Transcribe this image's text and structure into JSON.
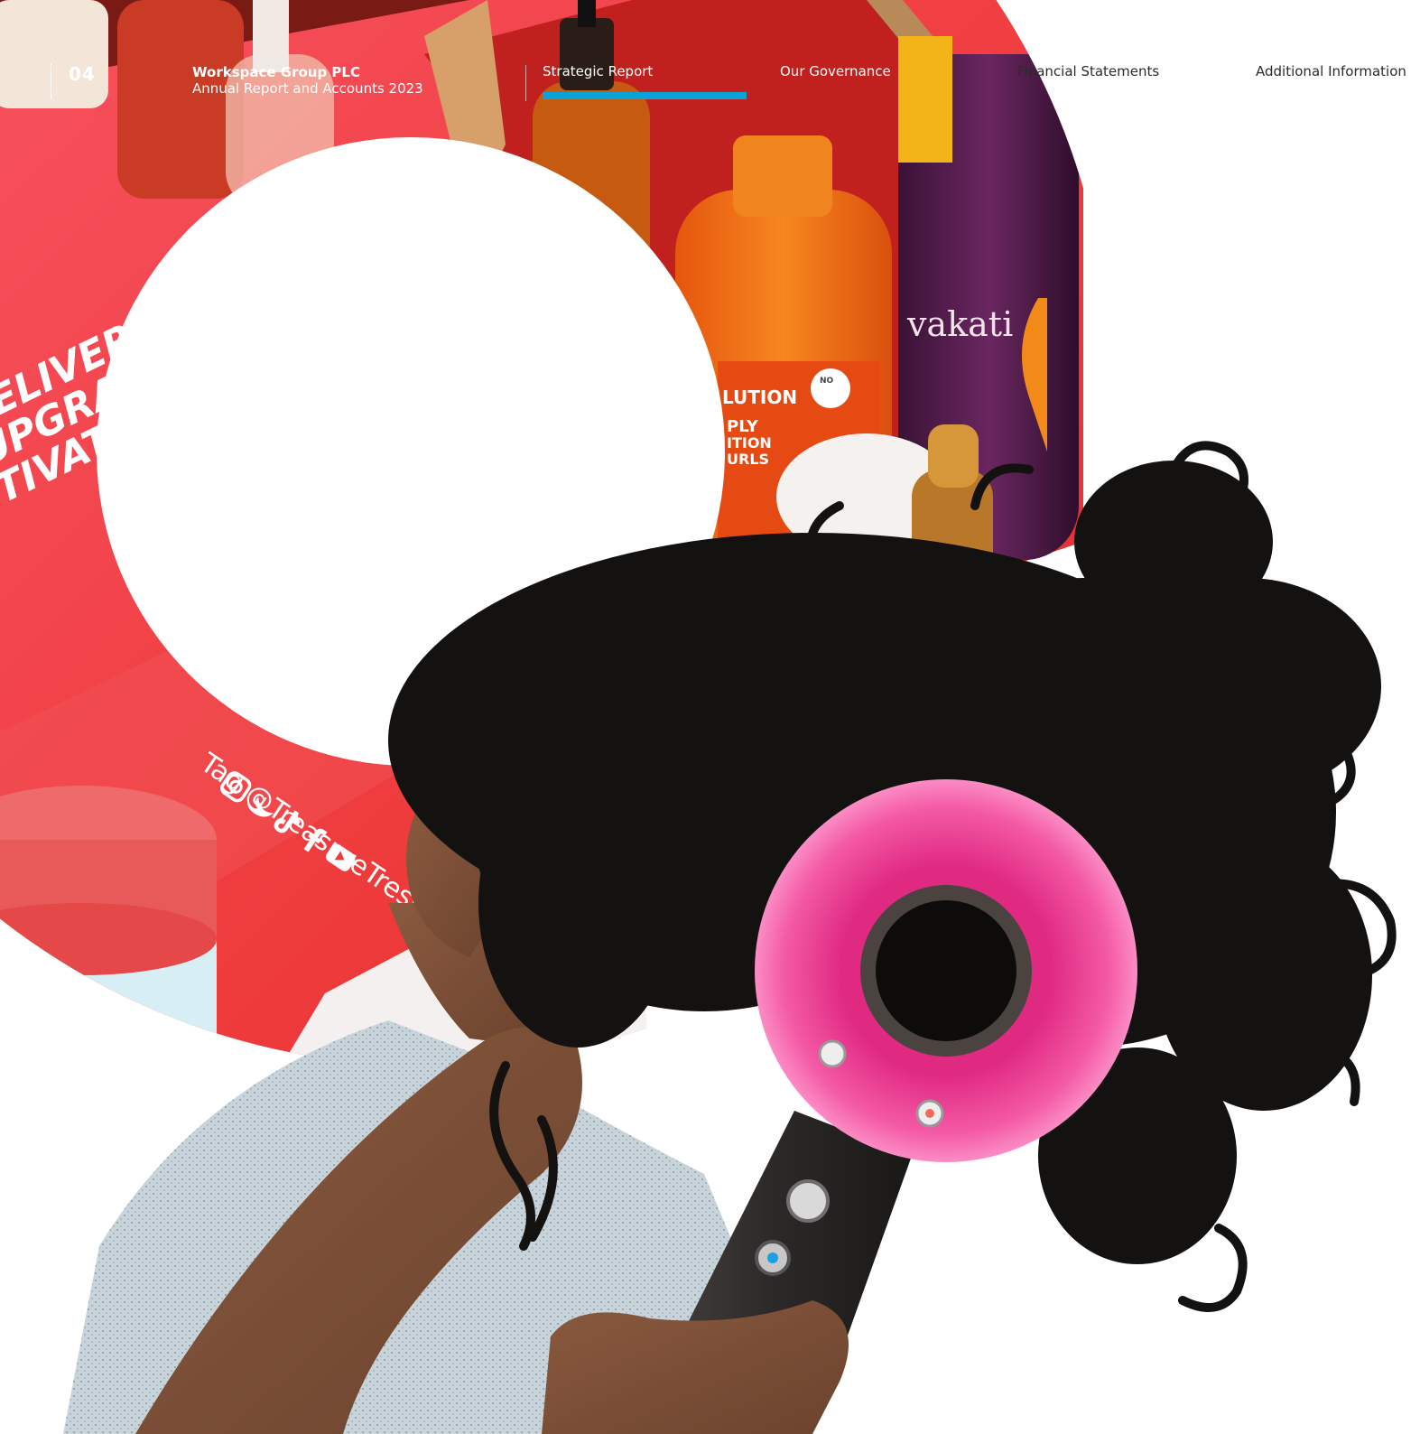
{
  "header": {
    "page_number": "04",
    "company_name": "Workspace Group PLC",
    "report_title": "Annual Report and Accounts 2023"
  },
  "nav": {
    "tabs": [
      {
        "label": "Strategic Report",
        "active": true
      },
      {
        "label": "Our Governance",
        "active": false
      },
      {
        "label": "Financial Statements",
        "active": false
      },
      {
        "label": "Additional Information",
        "active": false
      }
    ]
  },
  "photo_text": {
    "box_slogan_line1": "DELIVER",
    "box_slogan_line2": "UPGRADE",
    "box_slogan_line3": "TIVATED!",
    "bottle_brand": "vakati",
    "bottle_label_line1": "LUTION",
    "bottle_label_line2": "PLY",
    "bottle_label_line3": "ITION",
    "bottle_label_line4": "URLS",
    "bottle_badge": "NO",
    "box_tag": "Tag @TreasureTress"
  },
  "colors": {
    "box_red": "#ee3a3a",
    "box_pink": "#f5566a",
    "nav_accent": "#0aa3d8",
    "dryer_pink": "#f0479a",
    "dryer_grey": "#3c3836",
    "hair_black": "#141210",
    "bottle_orange": "#f2741c",
    "bottle_purple": "#5a1f4e"
  },
  "icons": [
    "instagram-icon",
    "twitter-icon",
    "tiktok-icon",
    "facebook-icon",
    "youtube-icon"
  ]
}
